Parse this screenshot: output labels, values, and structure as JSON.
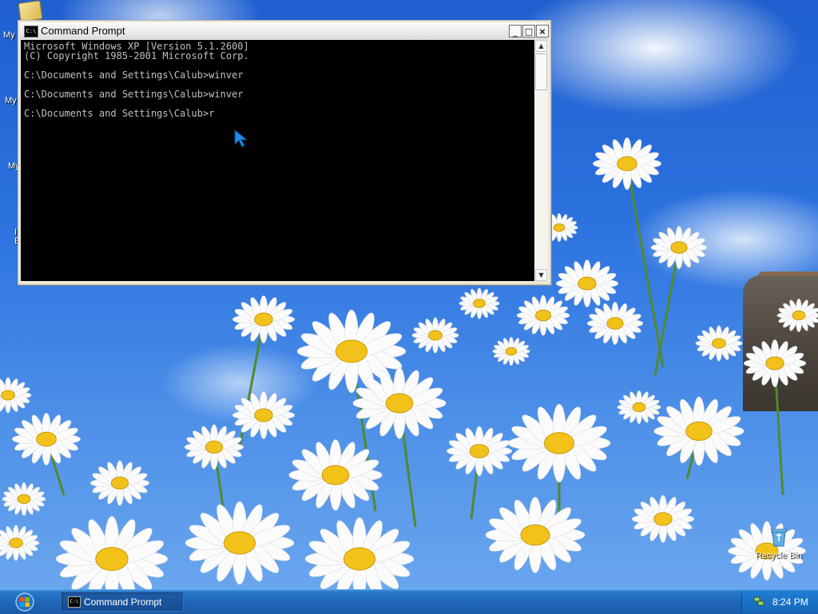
{
  "desktop": {
    "partial_icon_labels": [
      "My",
      "My",
      "My",
      "I",
      "E"
    ],
    "recycle_bin": {
      "label": "Recycle Bin",
      "icon": "recycle-bin-icon"
    }
  },
  "window": {
    "title": "Command Prompt",
    "icon": "cmd-icon",
    "icon_text": "C:\\",
    "buttons": {
      "minimize": "_",
      "maximize": "□",
      "close": "×"
    },
    "console": {
      "lines": [
        "Microsoft Windows XP [Version 5.1.2600]",
        "(C) Copyright 1985-2001 Microsoft Corp.",
        "",
        "C:\\Documents and Settings\\Calub>winver",
        "",
        "C:\\Documents and Settings\\Calub>winver",
        "",
        "C:\\Documents and Settings\\Calub>r"
      ]
    },
    "scrollbar": {
      "up": "▲",
      "down": "▼"
    }
  },
  "taskbar": {
    "start_icon": "windows-start-icon",
    "tasks": [
      {
        "label": "Command Prompt",
        "icon": "cmd-icon",
        "icon_text": "C:\\",
        "active": true
      }
    ],
    "tray": {
      "clock": "8:24 PM",
      "icon": "network-icon"
    }
  },
  "colors": {
    "console_bg": "#000000",
    "console_fg": "#c0c0c0",
    "taskbar": "#1f66b8",
    "sky": "#2d74e0"
  }
}
